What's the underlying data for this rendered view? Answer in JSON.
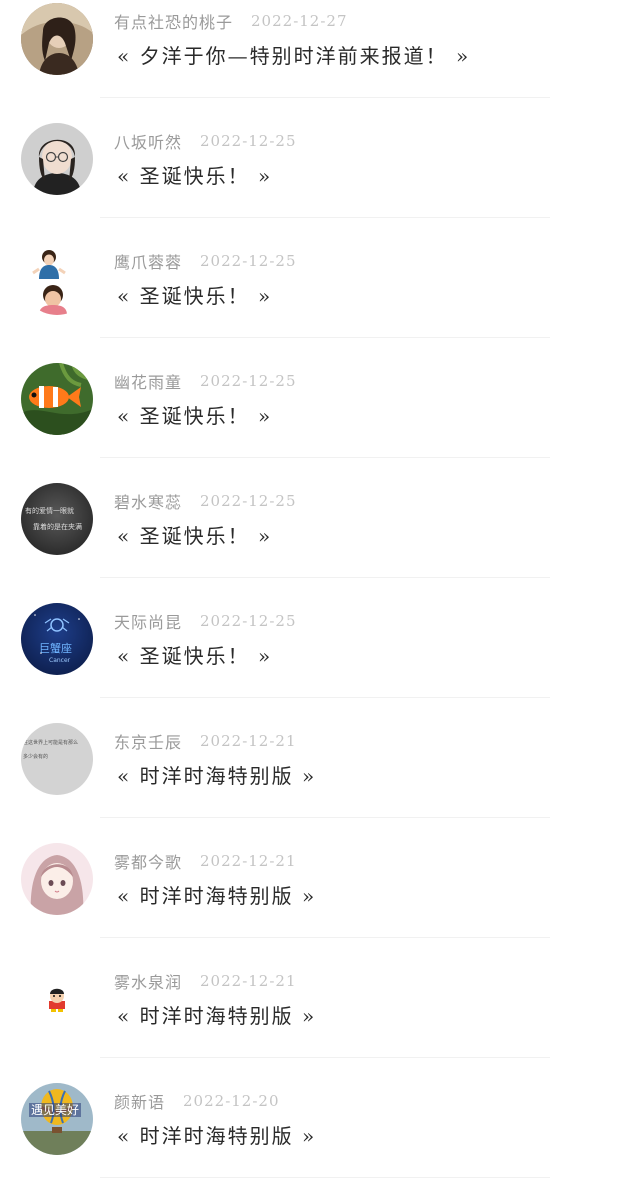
{
  "articles": [
    {
      "author": "有点社恐的桃子",
      "date": "2022-12-27",
      "title": "« 夕洋于你—特别时洋前来报道！ »",
      "avatar": "girl-photo"
    },
    {
      "author": "八坂听然",
      "date": "2022-12-25",
      "title": "« 圣诞快乐！ »",
      "avatar": "glasses-girl"
    },
    {
      "author": "鹰爪蓉蓉",
      "date": "2022-12-25",
      "title": "« 圣诞快乐！ »",
      "avatar": "two-kids"
    },
    {
      "author": "幽花雨童",
      "date": "2022-12-25",
      "title": "« 圣诞快乐！ »",
      "avatar": "clownfish"
    },
    {
      "author": "碧水寒蕊",
      "date": "2022-12-25",
      "title": "« 圣诞快乐！ »",
      "avatar": "dark-text",
      "avatar_text": [
        "有的爱情一眼就",
        "靠着的是在夹满"
      ]
    },
    {
      "author": "天际尚昆",
      "date": "2022-12-25",
      "title": "« 圣诞快乐！ »",
      "avatar": "zodiac",
      "avatar_text": [
        "巨蟹座",
        "Cancer"
      ]
    },
    {
      "author": "东京壬辰",
      "date": "2022-12-21",
      "title": "« 时洋时海特别版 »",
      "avatar": "grey-text",
      "avatar_text": [
        "在这世界上可能是有那么",
        "多少会有的"
      ]
    },
    {
      "author": "雾都今歌",
      "date": "2022-12-21",
      "title": "« 时洋时海特别版 »",
      "avatar": "anime-girl"
    },
    {
      "author": "雾水泉润",
      "date": "2022-12-21",
      "title": "« 时洋时海特别版 »",
      "avatar": "cartoon-boy"
    },
    {
      "author": "颜新语",
      "date": "2022-12-20",
      "title": "« 时洋时海特别版 »",
      "avatar": "balloon",
      "avatar_text": [
        "遇见美好"
      ]
    }
  ]
}
